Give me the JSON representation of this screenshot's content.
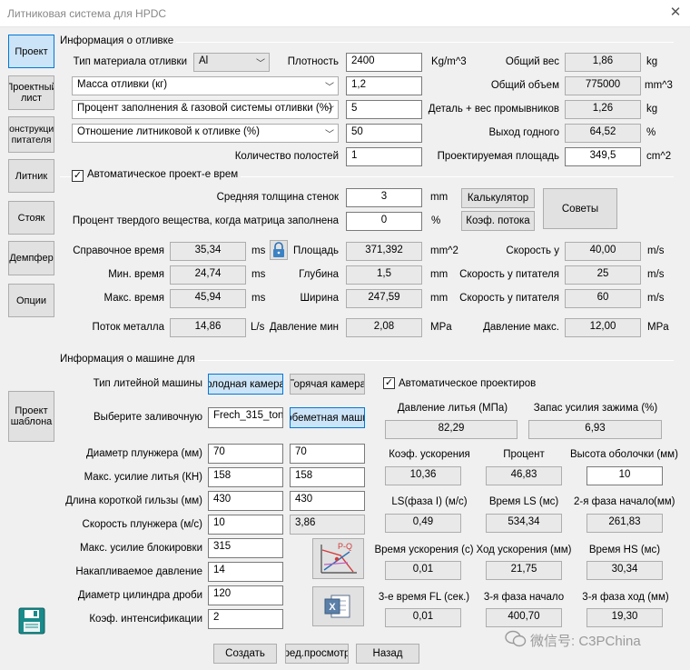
{
  "window": {
    "title": "Литниковая система для HPDC",
    "close_glyph": "✕"
  },
  "nav": {
    "proekt": "Проект",
    "proektny_list": "Проектный лист",
    "konstrukciya": "Конструкция питателя",
    "litnik": "Литник",
    "stoyak": "Стояк",
    "dempfer": "Демпфер",
    "opcii": "Опции",
    "shablon": "Проект шаблона"
  },
  "casting": {
    "title": "Информация о отливке",
    "material_label": "Тип материала отливки",
    "material_value": "Al",
    "density_label": "Плотность",
    "density_value": "2400",
    "density_unit": "Kg/m^3",
    "total_weight_label": "Общий вес",
    "total_weight_value": "1,86",
    "total_weight_unit": "kg",
    "combo1": "Масса отливки (кг)",
    "combo1_value": "1,2",
    "total_volume_label": "Общий объем",
    "total_volume_value": "775000",
    "total_volume_unit": "mm^3",
    "combo2": "Процент заполнения & газовой системы отливки (%)",
    "combo2_value": "5",
    "part_wash_label": "Деталь + вес промывников",
    "part_wash_value": "1,26",
    "part_wash_unit": "kg",
    "combo3": "Отношение литниковой к отливке (%)",
    "combo3_value": "50",
    "yield_label": "Выход годного",
    "yield_value": "64,52",
    "yield_unit": "%",
    "cavities_label": "Количество полостей",
    "cavities_value": "1",
    "proj_area_label": "Проектируемая площадь",
    "proj_area_value": "349,5",
    "proj_area_unit": "cm^2"
  },
  "auto_design": {
    "label": "Автоматическое проект-е врем",
    "wall_label": "Средняя толщина стенок",
    "wall_value": "3",
    "wall_unit": "mm",
    "solid_label": "Процент твердого вещества, когда матрица заполнена",
    "solid_value": "0",
    "solid_unit": "%",
    "calc_button": "Калькулятор",
    "flow_button": "Коэф. потока",
    "tips_button": "Советы"
  },
  "fill": {
    "ref_time_label": "Справочное время",
    "ref_time_value": "35,34",
    "ref_time_unit": "ms",
    "area_label": "Площадь",
    "area_value": "371,392",
    "area_unit": "mm^2",
    "speed_label": "Скорость у",
    "speed_value": "40,00",
    "speed_unit": "m/s",
    "min_time_label": "Мин. время",
    "min_time_value": "24,74",
    "min_time_unit": "ms",
    "depth_label": "Глубина",
    "depth_value": "1,5",
    "depth_unit": "mm",
    "gate_speed_label1": "Скорость у питателя",
    "gate_speed_value1": "25",
    "gate_speed_unit1": "m/s",
    "max_time_label": "Макс. время",
    "max_time_value": "45,94",
    "max_time_unit": "ms",
    "width_label": "Ширина",
    "width_value": "247,59",
    "width_unit": "mm",
    "gate_speed_label2": "Скорость у питателя",
    "gate_speed_value2": "60",
    "gate_speed_unit2": "m/s",
    "flow_label": "Поток металла",
    "flow_value": "14,86",
    "flow_unit": "L/s",
    "pmin_label": "Давление мин",
    "pmin_value": "2,08",
    "pmin_unit": "MPa",
    "pmax_label": "Давление макс.",
    "pmax_value": "12,00",
    "pmax_unit": "MPa"
  },
  "machine": {
    "title": "Информация о машине для",
    "type_label": "Тип литейной машины",
    "cold_button": "олодная камера",
    "hot_button": "Горячая камера",
    "auto_label": "Автоматическое проектиров",
    "select_label": "Выберите заливочную",
    "select_value": "Frech_315_ton",
    "select_button": "обеметная маши",
    "plunger_d_label": "Диаметр плунжера (мм)",
    "plunger_d_1": "70",
    "plunger_d_2": "70",
    "max_force_label": "Макс. усилие литья (КН)",
    "max_force_1": "158",
    "max_force_2": "158",
    "sleeve_label": "Длина короткой гильзы (мм)",
    "sleeve_1": "430",
    "sleeve_2": "430",
    "plunger_speed_label": "Скорость плунжера (м/с)",
    "plunger_speed_1": "10",
    "plunger_speed_2": "3,86",
    "lock_force_label": "Макс. усилие блокировки",
    "lock_force_value": "315",
    "accum_label": "Накапливаемое давление",
    "accum_value": "14",
    "shot_cyl_label": "Диаметр цилиндра дроби",
    "shot_cyl_value": "120",
    "intens_label": "Коэф. интенсификации",
    "intens_value": "2",
    "pq_label": "P-Q",
    "excel_label": "X"
  },
  "results": {
    "cast_p_label": "Давление литья (МПа)",
    "cast_p_value": "82,29",
    "clamp_label": "Запас усилия зажима (%)",
    "clamp_value": "6,93",
    "accel_label": "Коэф. ускорения",
    "accel_value": "10,36",
    "percent_label": "Процент",
    "percent_value": "46,83",
    "shell_label": "Высота оболочки (мм)",
    "shell_value": "10",
    "ls1_label": "LS(фаза I) (м/с)",
    "ls1_value": "0,49",
    "ls_time_label": "Время LS (мс)",
    "ls_time_value": "534,34",
    "ph2_start_label": "2-я фаза начало",
    "ph2_start_unit": "(мм)",
    "ph2_start_value": "261,83",
    "acc_time_label": "Время ускорения (с)",
    "acc_time_value": "0,01",
    "acc_stroke_label": "Ход ускорения (мм)",
    "acc_stroke_value": "21,75",
    "hs_time_label": "Время HS (мс)",
    "hs_time_value": "30,34",
    "fl3_label": "3-е время FL (сек.)",
    "fl3_value": "0,01",
    "ph3_start_label": "3-я фаза начало",
    "ph3_start_value": "400,70",
    "ph3_stroke_label": "3-я фаза ход (мм)",
    "ph3_stroke_value": "19,30"
  },
  "bottom": {
    "create": "Создать",
    "preview": "ред.просмотр",
    "back": "Назад"
  },
  "watermark": "微信号: C3PChina"
}
